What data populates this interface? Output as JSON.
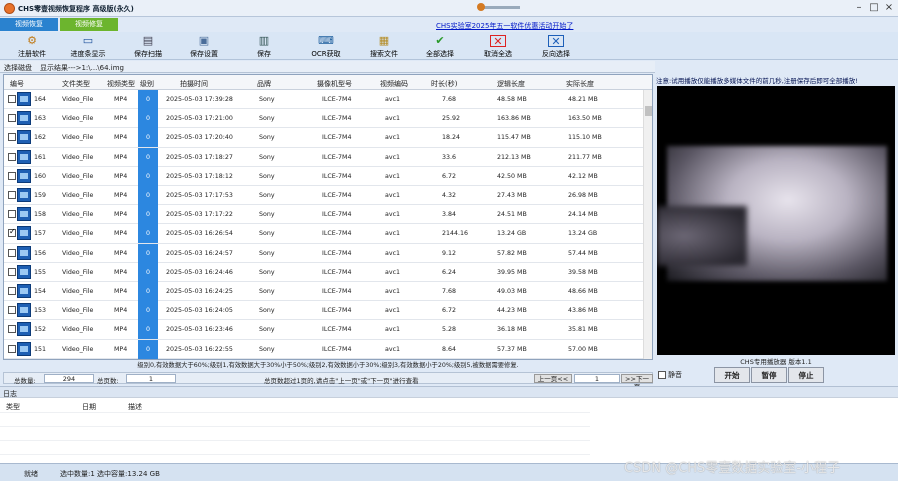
{
  "window": {
    "title": "CHS零壹视频恢复程序 高级版(永久)"
  },
  "tabs": [
    {
      "label": "视频恢复"
    },
    {
      "label": "视频修复"
    }
  ],
  "promo_link": "CHS实验室2025年五一软件优惠活动开始了",
  "toolbar": [
    {
      "label": "注册软件",
      "icon": "gear-icon"
    },
    {
      "label": "进度条显示",
      "icon": "monitor-icon"
    },
    {
      "label": "保存扫描",
      "icon": "disk-icon"
    },
    {
      "label": "保存设置",
      "icon": "folder-icon"
    },
    {
      "label": "保存",
      "icon": "printer-icon"
    },
    {
      "label": "OCR获取",
      "icon": "ocr-icon"
    },
    {
      "label": "搜索文件",
      "icon": "search-icon"
    },
    {
      "label": "全部选择",
      "icon": "check-icon"
    },
    {
      "label": "取消全选",
      "icon": "close-icon"
    },
    {
      "label": "反向选择",
      "icon": "invert-icon"
    }
  ],
  "pathbar": {
    "label": "选择磁盘",
    "path": "显示结果--->1:\\...\\64.img"
  },
  "columns": [
    "编号",
    "文件类型",
    "视频类型",
    "级别",
    "拍摄时间",
    "品牌",
    "摄像机型号",
    "视频编码",
    "时长(秒)",
    "逻辑长度",
    "实际长度"
  ],
  "rows": [
    {
      "id": "164",
      "ftype": "Video_File",
      "vtype": "MP4",
      "level": "0",
      "time": "2025-05-03 17:39:28",
      "brand": "Sony",
      "model": "ILCE-7M4",
      "codec": "avc1",
      "dur": "7.68",
      "logical": "48.58 MB",
      "actual": "48.21 MB",
      "checked": false
    },
    {
      "id": "163",
      "ftype": "Video_File",
      "vtype": "MP4",
      "level": "0",
      "time": "2025-05-03 17:21:00",
      "brand": "Sony",
      "model": "ILCE-7M4",
      "codec": "avc1",
      "dur": "25.92",
      "logical": "163.86 MB",
      "actual": "163.50 MB",
      "checked": false
    },
    {
      "id": "162",
      "ftype": "Video_File",
      "vtype": "MP4",
      "level": "0",
      "time": "2025-05-03 17:20:40",
      "brand": "Sony",
      "model": "ILCE-7M4",
      "codec": "avc1",
      "dur": "18.24",
      "logical": "115.47 MB",
      "actual": "115.10 MB",
      "checked": false
    },
    {
      "id": "161",
      "ftype": "Video_File",
      "vtype": "MP4",
      "level": "0",
      "time": "2025-05-03 17:18:27",
      "brand": "Sony",
      "model": "ILCE-7M4",
      "codec": "avc1",
      "dur": "33.6",
      "logical": "212.13 MB",
      "actual": "211.77 MB",
      "checked": false
    },
    {
      "id": "160",
      "ftype": "Video_File",
      "vtype": "MP4",
      "level": "0",
      "time": "2025-05-03 17:18:12",
      "brand": "Sony",
      "model": "ILCE-7M4",
      "codec": "avc1",
      "dur": "6.72",
      "logical": "42.50 MB",
      "actual": "42.12 MB",
      "checked": false
    },
    {
      "id": "159",
      "ftype": "Video_File",
      "vtype": "MP4",
      "level": "0",
      "time": "2025-05-03 17:17:53",
      "brand": "Sony",
      "model": "ILCE-7M4",
      "codec": "avc1",
      "dur": "4.32",
      "logical": "27.43 MB",
      "actual": "26.98 MB",
      "checked": false
    },
    {
      "id": "158",
      "ftype": "Video_File",
      "vtype": "MP4",
      "level": "0",
      "time": "2025-05-03 17:17:22",
      "brand": "Sony",
      "model": "ILCE-7M4",
      "codec": "avc1",
      "dur": "3.84",
      "logical": "24.51 MB",
      "actual": "24.14 MB",
      "checked": false
    },
    {
      "id": "157",
      "ftype": "Video_File",
      "vtype": "MP4",
      "level": "0",
      "time": "2025-05-03 16:26:54",
      "brand": "Sony",
      "model": "ILCE-7M4",
      "codec": "avc1",
      "dur": "2144.16",
      "logical": "13.24 GB",
      "actual": "13.24 GB",
      "checked": true
    },
    {
      "id": "156",
      "ftype": "Video_File",
      "vtype": "MP4",
      "level": "0",
      "time": "2025-05-03 16:24:57",
      "brand": "Sony",
      "model": "ILCE-7M4",
      "codec": "avc1",
      "dur": "9.12",
      "logical": "57.82 MB",
      "actual": "57.44 MB",
      "checked": false
    },
    {
      "id": "155",
      "ftype": "Video_File",
      "vtype": "MP4",
      "level": "0",
      "time": "2025-05-03 16:24:46",
      "brand": "Sony",
      "model": "ILCE-7M4",
      "codec": "avc1",
      "dur": "6.24",
      "logical": "39.95 MB",
      "actual": "39.58 MB",
      "checked": false
    },
    {
      "id": "154",
      "ftype": "Video_File",
      "vtype": "MP4",
      "level": "0",
      "time": "2025-05-03 16:24:25",
      "brand": "Sony",
      "model": "ILCE-7M4",
      "codec": "avc1",
      "dur": "7.68",
      "logical": "49.03 MB",
      "actual": "48.66 MB",
      "checked": false
    },
    {
      "id": "153",
      "ftype": "Video_File",
      "vtype": "MP4",
      "level": "0",
      "time": "2025-05-03 16:24:05",
      "brand": "Sony",
      "model": "ILCE-7M4",
      "codec": "avc1",
      "dur": "6.72",
      "logical": "44.23 MB",
      "actual": "43.86 MB",
      "checked": false
    },
    {
      "id": "152",
      "ftype": "Video_File",
      "vtype": "MP4",
      "level": "0",
      "time": "2025-05-03 16:23:46",
      "brand": "Sony",
      "model": "ILCE-7M4",
      "codec": "avc1",
      "dur": "5.28",
      "logical": "36.18 MB",
      "actual": "35.81 MB",
      "checked": false
    },
    {
      "id": "151",
      "ftype": "Video_File",
      "vtype": "MP4",
      "level": "0",
      "time": "2025-05-03 16:22:55",
      "brand": "Sony",
      "model": "ILCE-7M4",
      "codec": "avc1",
      "dur": "8.64",
      "logical": "57.37 MB",
      "actual": "57.00 MB",
      "checked": false
    }
  ],
  "legend": "级别0,有效数据大于60%;级别1,有效数据大于30%小于50%;级别2,有效数据小于30%;级别3,有效数据小于20%;级别5,被数据需要修复.",
  "status": {
    "total_label": "总数量:",
    "total": "294",
    "pages_label": "总页数:",
    "pages": "1",
    "hint": "总页数超过1页的,请点击\"上一页\"或\"下一页\"进行查看",
    "prev": "上一页<<",
    "page": "1",
    "next": ">>下一页"
  },
  "preview": {
    "note": "注意:试用播放仅能播放多媒体文件的前几秒,注册保存后即可全部播放!",
    "player_label": "CHS专用播放器 版本1.1",
    "mute_label": "静音",
    "start": "开始",
    "pause": "暂停",
    "stop": "停止"
  },
  "log": {
    "title": "日志",
    "cols": [
      "类型",
      "日期",
      "描述"
    ]
  },
  "footer": {
    "state": "就绪",
    "selection": "选中数量:1 选中容量:13.24 GB"
  },
  "watermark": "CSDN @CHS零壹数据实验室-小程子"
}
